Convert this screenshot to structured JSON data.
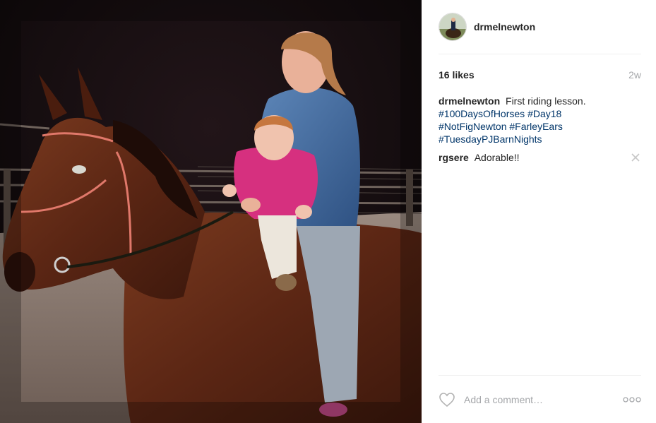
{
  "post": {
    "photo_alt": "",
    "author": {
      "username": "drmelnewton",
      "avatar_icon": "avatar-photo"
    },
    "likes": "16 likes",
    "timestamp": "2w",
    "caption": {
      "author": "drmelnewton",
      "text": "First riding lesson.",
      "hashtags": [
        "#100DaysOfHorses",
        "#Day18",
        "#NotFigNewton",
        "#FarleyEars",
        "#TuesdayPJBarnNights"
      ]
    },
    "comments": [
      {
        "author": "rgsere",
        "text": "Adorable!!",
        "remove_icon": "close-icon"
      }
    ],
    "footer": {
      "like_icon": "heart-outline-icon",
      "comment_placeholder": "Add a comment…",
      "more_icon": "ellipsis-icon"
    }
  },
  "colors": {
    "link": "#003569",
    "muted": "#a5a7aa",
    "text": "#262626",
    "divider": "#efefef"
  }
}
